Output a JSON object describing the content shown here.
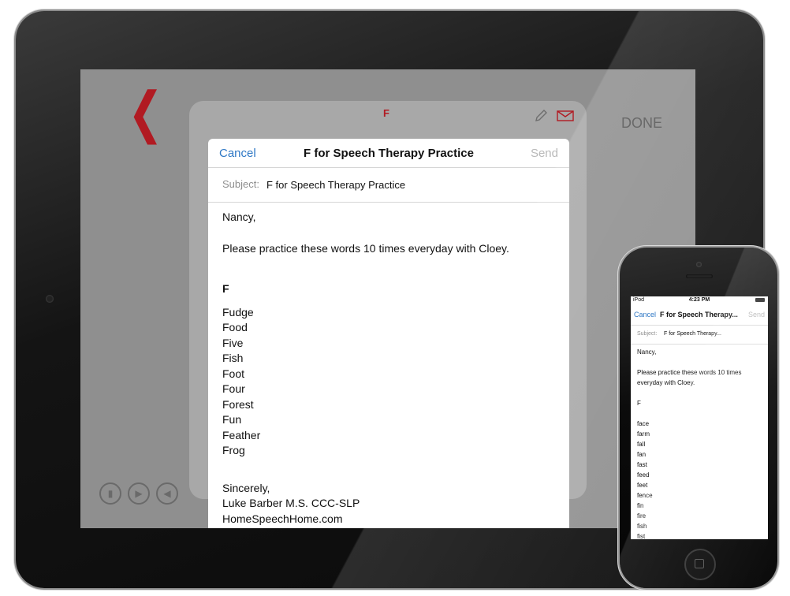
{
  "ipad": {
    "app": {
      "back_icon": "chevron-left-icon",
      "done_label": "DONE",
      "card_letter": "F",
      "edit_icon": "pencil-icon",
      "mail_icon": "envelope-icon",
      "bottom_icons": [
        "microphone-icon",
        "play-icon",
        "speaker-icon"
      ],
      "accent_color": "#b11a22"
    },
    "compose": {
      "cancel_label": "Cancel",
      "title": "F for Speech Therapy Practice",
      "send_label": "Send",
      "subject_label": "Subject:",
      "subject_value": "F for Speech Therapy Practice",
      "greeting": "Nancy,",
      "message": "Please practice these words 10 times everyday with Cloey.",
      "letter_heading": "F",
      "words": [
        "Fudge",
        "Food",
        "Five",
        "Fish",
        "Foot",
        "Four",
        "Forest",
        "Fun",
        "Feather",
        "Frog"
      ],
      "closing": "Sincerely,",
      "signature": "Luke Barber M.S. CCC-SLP",
      "website": "HomeSpeechHome.com"
    }
  },
  "iphone": {
    "status": {
      "carrier": "iPod",
      "time": "4:23 PM"
    },
    "compose": {
      "cancel_label": "Cancel",
      "title": "F for Speech Therapy...",
      "send_label": "Send",
      "subject_label": "Subject:",
      "subject_value": "F for Speech Therapy...",
      "greeting": "Nancy,",
      "message": "Please practice these words 10 times everyday with Cloey.",
      "letter_heading": "F",
      "words": [
        "face",
        "farm",
        "fall",
        "fan",
        "fast",
        "feed",
        "feet",
        "fence",
        "fin",
        "fire",
        "fish",
        "fist"
      ]
    }
  }
}
